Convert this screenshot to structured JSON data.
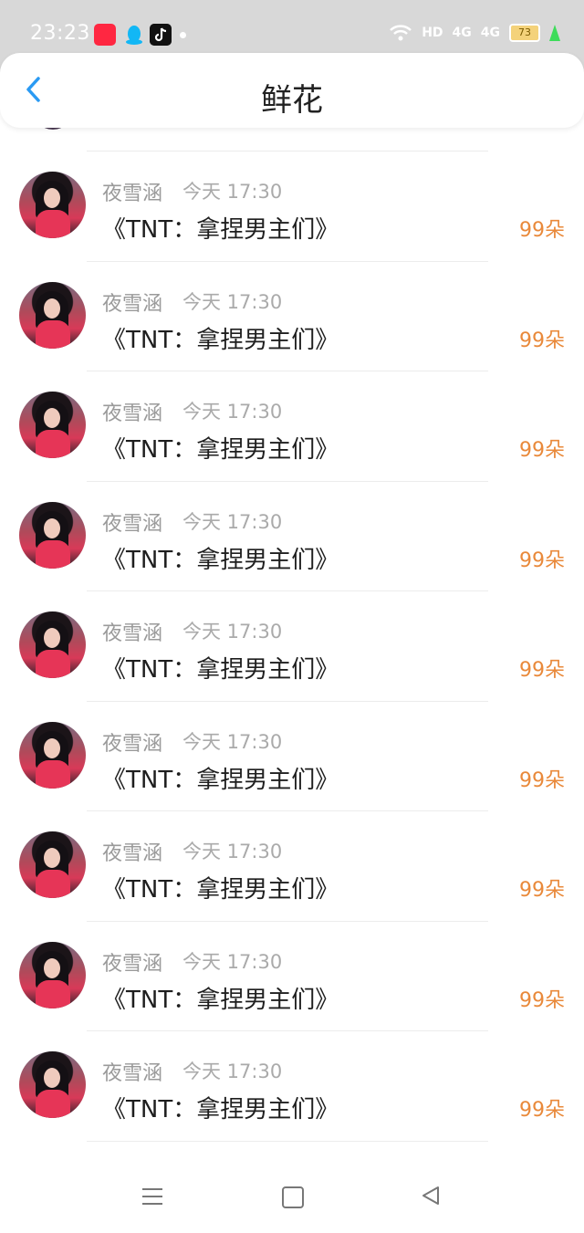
{
  "status_bar": {
    "time": "23:23",
    "app_icons": [
      "xiaohongshu-icon",
      "qq-icon",
      "tiktok-icon"
    ],
    "network_labels": [
      "4G",
      "4G"
    ],
    "hd_label": "HD",
    "battery": "73",
    "charging": true
  },
  "header": {
    "title": "鲜花",
    "back_icon": "chevron-left-icon"
  },
  "rows": [
    {
      "name": "夜雪涵",
      "time": "今天 17:30",
      "work": "《TNT：拿捏男主们》",
      "amount": "99朵"
    },
    {
      "name": "夜雪涵",
      "time": "今天 17:30",
      "work": "《TNT：拿捏男主们》",
      "amount": "99朵"
    },
    {
      "name": "夜雪涵",
      "time": "今天 17:30",
      "work": "《TNT：拿捏男主们》",
      "amount": "99朵"
    },
    {
      "name": "夜雪涵",
      "time": "今天 17:30",
      "work": "《TNT：拿捏男主们》",
      "amount": "99朵"
    },
    {
      "name": "夜雪涵",
      "time": "今天 17:30",
      "work": "《TNT：拿捏男主们》",
      "amount": "99朵"
    },
    {
      "name": "夜雪涵",
      "time": "今天 17:30",
      "work": "《TNT：拿捏男主们》",
      "amount": "99朵"
    },
    {
      "name": "夜雪涵",
      "time": "今天 17:30",
      "work": "《TNT：拿捏男主们》",
      "amount": "99朵"
    },
    {
      "name": "夜雪涵",
      "time": "今天 17:30",
      "work": "《TNT：拿捏男主们》",
      "amount": "99朵"
    },
    {
      "name": "夜雪涵",
      "time": "今天 17:30",
      "work": "《TNT：拿捏男主们》",
      "amount": "99朵"
    }
  ],
  "nav_bar": {
    "icons": [
      "menu-icon",
      "home-icon",
      "back-triangle-icon"
    ]
  },
  "colors": {
    "accent_back": "#2a9af3",
    "amount": "#e9893a",
    "muted_text": "#9a9a9a",
    "status_bar_bg": "#d8d8d8"
  }
}
